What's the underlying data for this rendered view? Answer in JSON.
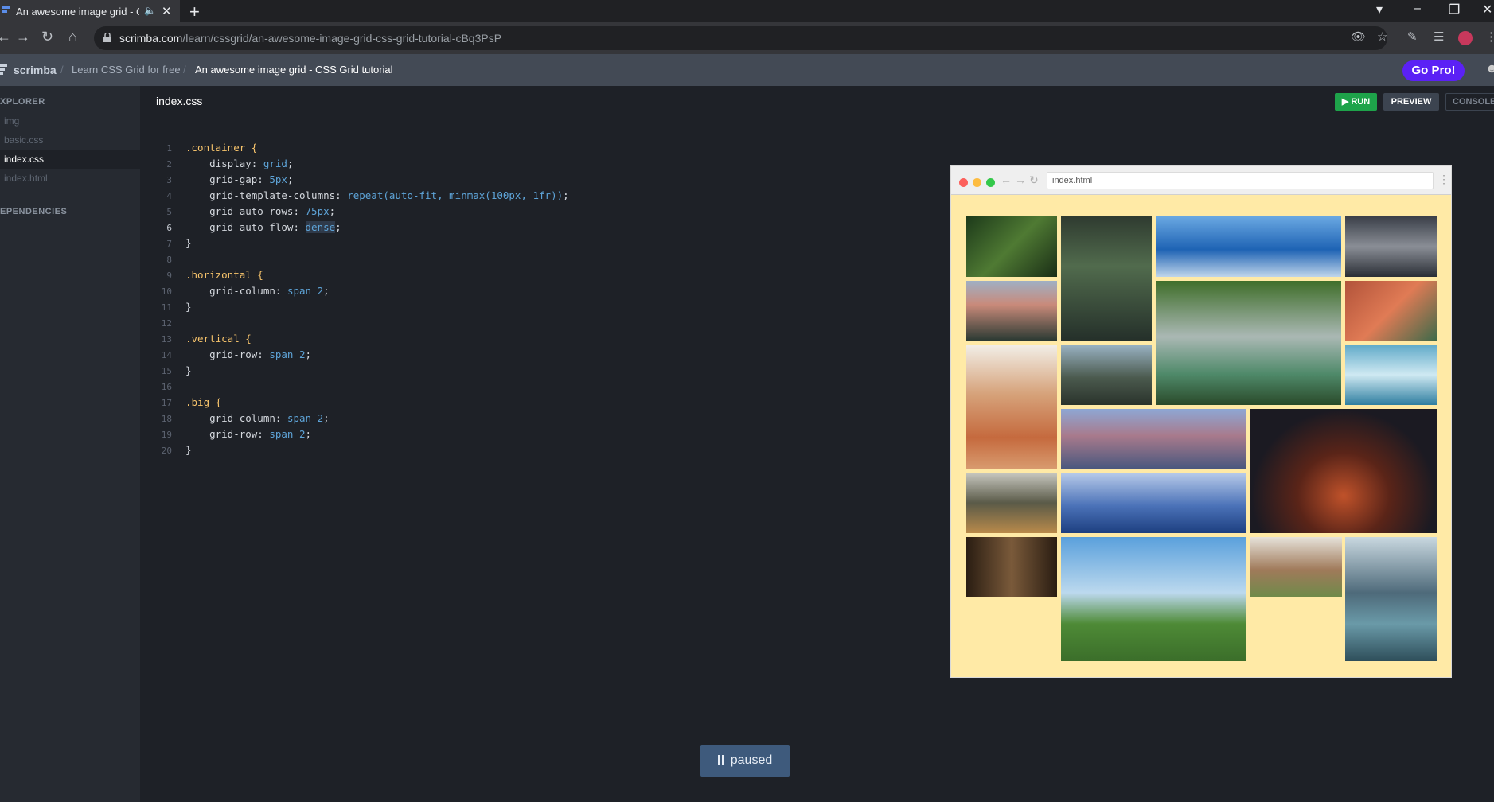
{
  "browser": {
    "tab_title": "An awesome image grid - CS",
    "url_host": "scrimba.com",
    "url_path": "/learn/cssgrid/an-awesome-image-grid-css-grid-tutorial-cBq3PsP"
  },
  "header": {
    "brand": "scrimba",
    "crumb_course": "Learn CSS Grid for free",
    "crumb_lesson": "An awesome image grid - CSS Grid tutorial",
    "go_pro": "Go Pro!"
  },
  "sidebar": {
    "explorer_heading": "XPLORER",
    "items": [
      {
        "label": "img"
      },
      {
        "label": "basic.css"
      },
      {
        "label": "index.css"
      },
      {
        "label": "index.html"
      }
    ],
    "dependencies_heading": "EPENDENCIES"
  },
  "editor": {
    "filename": "index.css",
    "run_label": "RUN",
    "preview_label": "PREVIEW",
    "console_label": "CONSOLE",
    "current_line": 6,
    "lines": [
      {
        "n": "1"
      },
      {
        "n": "2"
      },
      {
        "n": "3"
      },
      {
        "n": "4"
      },
      {
        "n": "5"
      },
      {
        "n": "6"
      },
      {
        "n": "7"
      },
      {
        "n": "8"
      },
      {
        "n": "9"
      },
      {
        "n": "10"
      },
      {
        "n": "11"
      },
      {
        "n": "12"
      },
      {
        "n": "13"
      },
      {
        "n": "14"
      },
      {
        "n": "15"
      },
      {
        "n": "16"
      },
      {
        "n": "17"
      },
      {
        "n": "18"
      },
      {
        "n": "19"
      },
      {
        "n": "20"
      }
    ],
    "code": {
      "l1": ".container {",
      "l2a": "    display: ",
      "l2b": "grid",
      "l2c": ";",
      "l3a": "    grid-gap: ",
      "l3b": "5px",
      "l3c": ";",
      "l4a": "    grid-template-columns: ",
      "l4b": "repeat(auto-fit, minmax(100px, 1fr))",
      "l4c": ";",
      "l5a": "    grid-auto-rows: ",
      "l5b": "75px",
      "l5c": ";",
      "l6a": "    grid-auto-flow: ",
      "l6b": "dense",
      "l6c": ";",
      "l7": "}",
      "l9": ".horizontal {",
      "l10a": "    grid-column: ",
      "l10b": "span 2",
      "l10c": ";",
      "l11": "}",
      "l13": ".vertical {",
      "l14a": "    grid-row: ",
      "l14b": "span 2",
      "l14c": ";",
      "l15": "}",
      "l17": ".big {",
      "l18a": "    grid-column: ",
      "l18b": "span 2",
      "l18c": ";",
      "l19a": "    grid-row: ",
      "l19b": "span 2",
      "l19c": ";",
      "l20": "}"
    }
  },
  "preview": {
    "url": "index.html"
  },
  "player": {
    "status": "paused"
  },
  "colors": {
    "run": "#1ea34a",
    "go_pro": "#5b21f5",
    "preview_bg": "#ffeaa6",
    "paused_bg": "#3e5a7c"
  }
}
